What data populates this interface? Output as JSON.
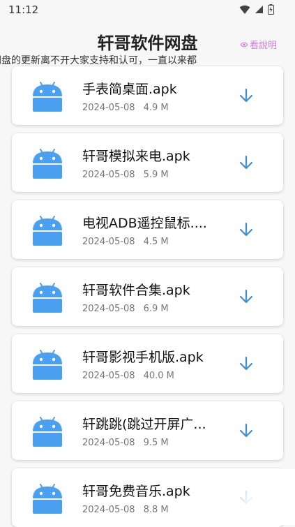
{
  "status": {
    "time": "11:12"
  },
  "header": {
    "title": "轩哥软件网盘",
    "help": "看說明",
    "marquee": "件网盘的更新离不开大家支持和认可，一直以来都"
  },
  "files": [
    {
      "name": "手表简桌面.apk",
      "date": "2024-05-08",
      "size": "4.9 M"
    },
    {
      "name": "轩哥模拟来电.apk",
      "date": "2024-05-08",
      "size": "5.9 M"
    },
    {
      "name": "电视ADB遥控鼠标....",
      "date": "2024-05-08",
      "size": "4.5 M"
    },
    {
      "name": "轩哥软件合集.apk",
      "date": "2024-05-08",
      "size": "6.9 M"
    },
    {
      "name": "轩哥影视手机版.apk",
      "date": "2024-05-08",
      "size": "40.0 M"
    },
    {
      "name": "轩跳跳(跳过开屏广...",
      "date": "2024-05-08",
      "size": "9.5 M"
    },
    {
      "name": "轩哥免费音乐.apk",
      "date": "2024-05-08",
      "size": "8.8 M"
    }
  ],
  "colors": {
    "accent": "#3d8fd8",
    "android_icon": "#4a9ff0",
    "help_link": "#d17fd8"
  },
  "icons": {
    "file": "android-icon",
    "download": "download-arrow-icon"
  }
}
